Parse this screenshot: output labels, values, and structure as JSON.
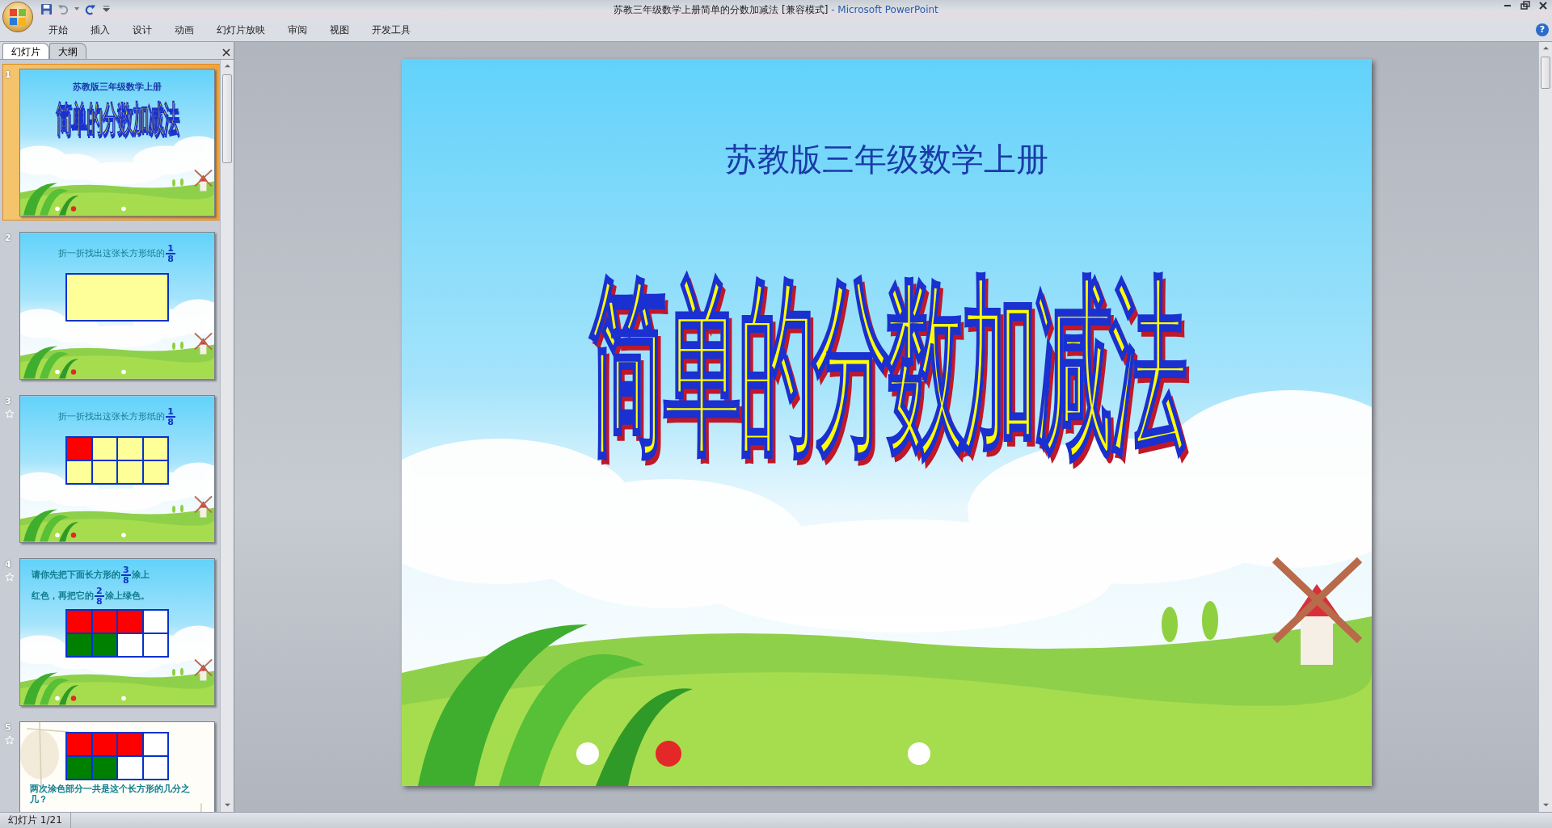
{
  "window": {
    "document_title": "苏教三年级数学上册简单的分数加减法 [兼容模式]",
    "app_name": "- Microsoft PowerPoint"
  },
  "ribbon_tabs": [
    "开始",
    "插入",
    "设计",
    "动画",
    "幻灯片放映",
    "审阅",
    "视图",
    "开发工具"
  ],
  "panel_tabs": [
    {
      "label": "幻灯片",
      "selected": true
    },
    {
      "label": "大纲",
      "selected": false
    }
  ],
  "thumbnails": [
    {
      "number": "1",
      "selected": true,
      "animated": false,
      "kind": "title",
      "backdrop": {
        "kind": "sky"
      },
      "subtitle": "苏教版三年级数学上册",
      "title": "简单的分数加减法"
    },
    {
      "number": "2",
      "selected": false,
      "animated": false,
      "kind": "exercise",
      "backdrop": {
        "kind": "sky"
      },
      "bold_text": false,
      "lines": [
        [
          {
            "kind": "text",
            "text": "折一折找出这张长方形纸的"
          },
          {
            "kind": "fraction",
            "numerator": "1",
            "denominator": "8"
          }
        ]
      ],
      "grid": [
        [
          {
            "color": "#ffff99"
          }
        ]
      ]
    },
    {
      "number": "3",
      "selected": false,
      "animated": true,
      "kind": "exercise",
      "backdrop": {
        "kind": "sky"
      },
      "bold_text": false,
      "lines": [
        [
          {
            "kind": "text",
            "text": "折一折找出这张长方形纸的"
          },
          {
            "kind": "fraction",
            "numerator": "1",
            "denominator": "8"
          }
        ]
      ],
      "grid": [
        [
          {
            "color": "#ff0000"
          },
          {
            "color": "#ffff99"
          },
          {
            "color": "#ffff99"
          },
          {
            "color": "#ffff99"
          }
        ],
        [
          {
            "color": "#ffff99"
          },
          {
            "color": "#ffff99"
          },
          {
            "color": "#ffff99"
          },
          {
            "color": "#ffff99"
          }
        ]
      ]
    },
    {
      "number": "4",
      "selected": false,
      "animated": true,
      "kind": "exercise",
      "backdrop": {
        "kind": "sky"
      },
      "bold_text": true,
      "lines": [
        [
          {
            "kind": "text",
            "text": "请你先把下面长方形的"
          },
          {
            "kind": "fraction",
            "numerator": "3",
            "denominator": "8"
          },
          {
            "kind": "text",
            "text": "涂上"
          }
        ],
        [
          {
            "kind": "text",
            "text": "红色，再把它的"
          },
          {
            "kind": "fraction",
            "numerator": "2",
            "denominator": "8"
          },
          {
            "kind": "text",
            "text": "涂上绿色。"
          }
        ]
      ],
      "grid": [
        [
          {
            "color": "#ff0000"
          },
          {
            "color": "#ff0000"
          },
          {
            "color": "#ff0000"
          },
          {
            "color": "#ffffff"
          }
        ],
        [
          {
            "color": "#008000"
          },
          {
            "color": "#008000"
          },
          {
            "color": "#ffffff"
          },
          {
            "color": "#ffffff"
          }
        ]
      ]
    },
    {
      "number": "5",
      "selected": false,
      "animated": true,
      "kind": "question",
      "backdrop": {
        "kind": "paper"
      },
      "bold_text": true,
      "lines": [
        [
          {
            "kind": "text",
            "text": "两次涂色部分一共是这个长方形的几分之几？"
          }
        ]
      ],
      "grid": [
        [
          {
            "color": "#ff0000"
          },
          {
            "color": "#ff0000"
          },
          {
            "color": "#ff0000"
          },
          {
            "color": "#ffffff"
          }
        ],
        [
          {
            "color": "#008000"
          },
          {
            "color": "#008000"
          },
          {
            "color": "#ffffff"
          },
          {
            "color": "#ffffff"
          }
        ]
      ]
    }
  ],
  "help_button": "?",
  "slide": {
    "backdrop": {
      "kind": "sky"
    },
    "subtitle": "苏教版三年级数学上册",
    "title": "简单的分数加减法"
  },
  "status_bar": {
    "slide_indicator": "幻灯片 1/21"
  }
}
